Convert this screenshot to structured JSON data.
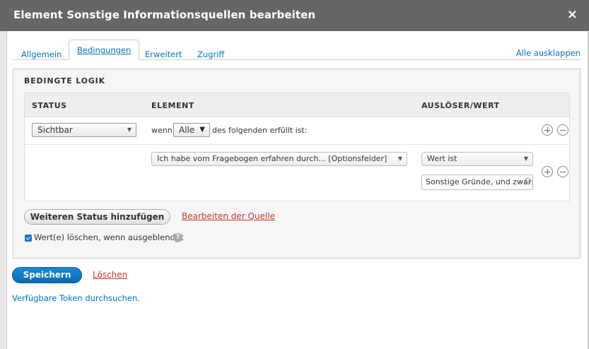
{
  "dialog": {
    "title": "Element Sonstige Informationsquellen bearbeiten",
    "close_label": "×"
  },
  "tabs": [
    {
      "label": "Allgemein"
    },
    {
      "label": "Bedingungen"
    },
    {
      "label": "Erweitert"
    },
    {
      "label": "Zugriff"
    }
  ],
  "expand_all": "Alle ausklappen",
  "panel": {
    "title": "BEDINGTE LOGIK",
    "headers": {
      "status": "STATUS",
      "element": "ELEMENT",
      "trigger": "AUSLÖSER/WERT"
    },
    "row1": {
      "status_value": "Sichtbar",
      "prefix": "wenn",
      "condition_value": "Alle",
      "suffix": "des folgenden erfüllt ist:"
    },
    "row2": {
      "element_value": "Ich habe vom Fragebogen erfahren durch... [Optionsfelder]",
      "trigger_value": "Wert ist",
      "value_input": "Sonstige Gründe, und zwar:"
    },
    "add_state_button": "Weiteren Status hinzufügen",
    "edit_source_link": "Bearbeiten der Quelle",
    "clear_values_label": "Wert(e) löschen, wenn ausgeblendet",
    "help": "?"
  },
  "actions": {
    "save": "Speichern",
    "delete": "Löschen"
  },
  "token_link": "Verfügbare Token durchsuchen."
}
